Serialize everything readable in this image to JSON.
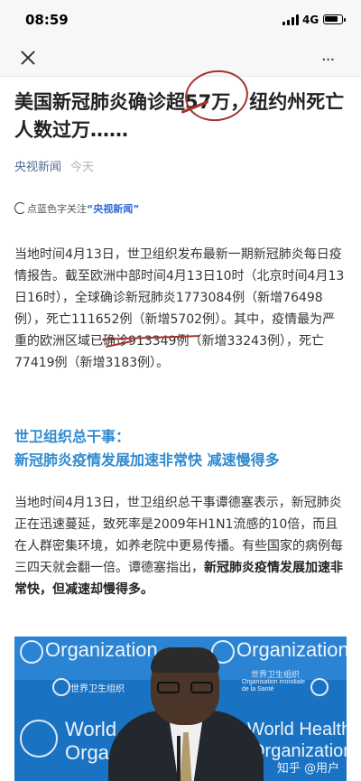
{
  "status_bar": {
    "time": "08:59",
    "network": "4G",
    "battery_level": 0.85
  },
  "nav": {
    "close_icon": "close-icon",
    "more_icon": "more-icon",
    "more_label": "···"
  },
  "article": {
    "title": "美国新冠肺炎确诊超57万，纽约州死亡人数过万……",
    "source": "央视新闻",
    "date": "今天",
    "follow_prefix": "点蓝色字关注",
    "follow_name": "“央视新闻”",
    "para1": "当地时间4月13日，世卫组织发布最新一期新冠肺炎每日疫情报告。截至欧洲中部时间4月13日10时（北京时间4月13日16时），全球确诊新冠肺炎1773084例（新增76498例），死亡111652例（新增5702例）。其中，疫情最为严重的欧洲区域已确诊913349例（新增33243例），死亡77419例（新增3183例）。",
    "section_line1": "世卫组织总干事：",
    "section_line2": "新冠肺炎疫情发展加速非常快 减速慢得多",
    "para2_start": "当地时间4月13日，世卫组织总干事谭德塞表示，新冠肺炎正在迅速蔓延，致死率是2009年H1N1流感的10倍，而且在人群密集环境，如养老院中更易传播。有些国家的病例每三四天就会翻一倍。谭德塞指出，",
    "para2_bold": "新冠肺炎疫情发展加速非常快，但减速却慢得多。"
  },
  "photo": {
    "backdrop_top_left": "Organization",
    "backdrop_top_right": "Organization",
    "backdrop_mid_left": "世界卫生组织",
    "backdrop_mid_right": "Organisation mondiale de la Santé",
    "backdrop_mid_right2": "世界卫生组织",
    "backdrop_bottom_left": "World",
    "backdrop_bottom_left2": "Orga",
    "backdrop_bottom_right": "World Health",
    "backdrop_bottom_right2": "Organization",
    "watermark": "知乎 @用户"
  },
  "colors": {
    "link": "#576b95",
    "heading_blue": "#2f8ad0",
    "annotation_red": "#a5322d"
  }
}
